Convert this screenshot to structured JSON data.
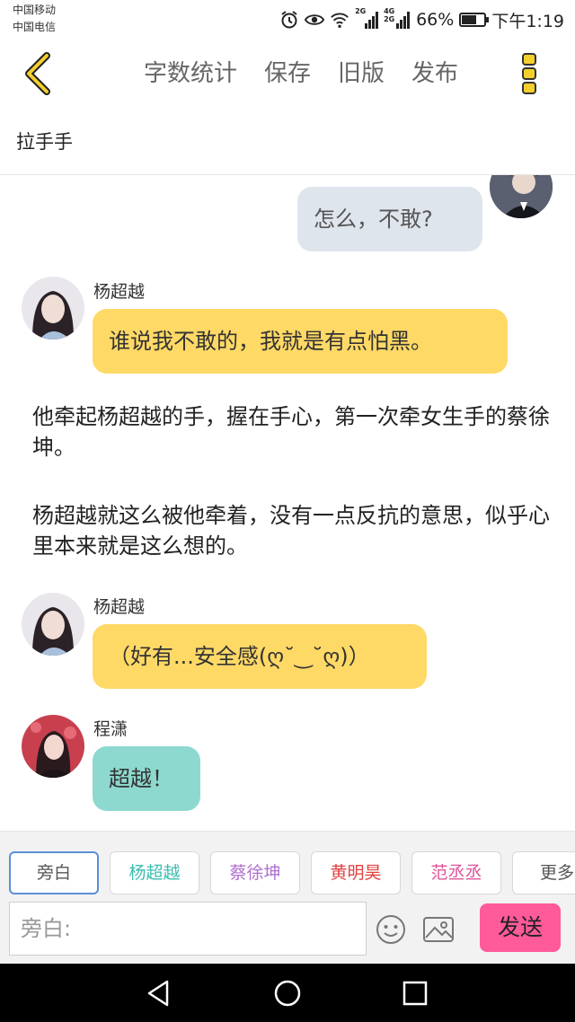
{
  "status_bar": {
    "carrier1": "中国移动",
    "carrier2": "中国电信",
    "network1": "2G",
    "network2": "4G 2G",
    "battery_text": "66%",
    "battery_level": 0.66,
    "time": "下午1:19"
  },
  "toolbar": {
    "word_count": "字数统计",
    "save": "保存",
    "old_version": "旧版",
    "publish": "发布"
  },
  "story": {
    "title": "拉手手"
  },
  "messages": {
    "m1": {
      "text": "怎么，不敢?"
    },
    "m2": {
      "speaker": "杨超越",
      "text": "谁说我不敢的，我就是有点怕黑。"
    },
    "n1": {
      "text": "他牵起杨超越的手，握在手心，第一次牵女生手的蔡徐坤。"
    },
    "n2": {
      "text": "杨超越就这么被他牵着，没有一点反抗的意思，似乎心里本来就是这么想的。"
    },
    "m3": {
      "speaker": "杨超越",
      "text": "（好有...安全感(ღ˘‿˘ღ)）"
    },
    "m4": {
      "speaker": "程潇",
      "text": "超越！"
    }
  },
  "roles": [
    {
      "label": "旁白",
      "color": "#555555"
    },
    {
      "label": "杨超越",
      "color": "#3dbdb0"
    },
    {
      "label": "蔡徐坤",
      "color": "#b070d0"
    },
    {
      "label": "黄明昊",
      "color": "#e04040"
    },
    {
      "label": "范丞丞",
      "color": "#e0559a"
    },
    {
      "label": "更多",
      "color": "#555555"
    }
  ],
  "composer": {
    "placeholder": "旁白:",
    "send": "发送"
  },
  "colors": {
    "accent_yellow": "#f2cf2c",
    "send_pink": "#ff5a9a",
    "bubble_yellow": "#ffd966",
    "bubble_teal": "#8dd9cf",
    "bubble_gray": "#dfe5ec"
  }
}
